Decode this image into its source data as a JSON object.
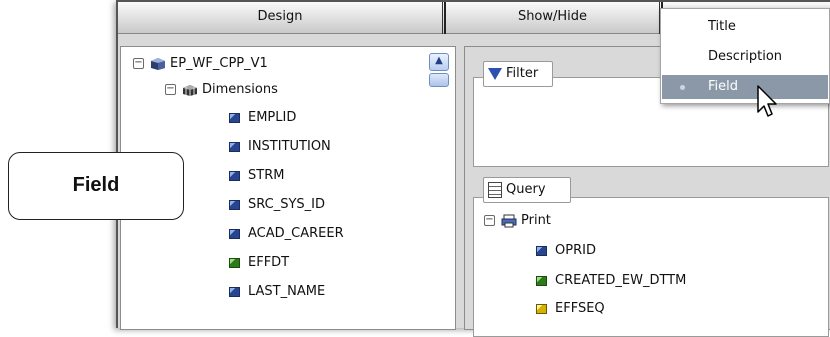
{
  "tabs": {
    "design": "Design",
    "show_hide": "Show/Hide"
  },
  "tree": {
    "root": "EP_WF_CPP_V1",
    "dimensions": "Dimensions",
    "fields": [
      {
        "label": "EMPLID",
        "icon": "field-blue-icon"
      },
      {
        "label": "INSTITUTION",
        "icon": "field-blue-icon"
      },
      {
        "label": "STRM",
        "icon": "field-blue-icon"
      },
      {
        "label": "SRC_SYS_ID",
        "icon": "field-blue-icon"
      },
      {
        "label": "ACAD_CAREER",
        "icon": "field-blue-icon"
      },
      {
        "label": "EFFDT",
        "icon": "field-green-icon"
      },
      {
        "label": "LAST_NAME",
        "icon": "field-blue-icon"
      }
    ]
  },
  "filter": {
    "label": "Filter"
  },
  "query": {
    "label": "Query",
    "print": "Print",
    "fields": [
      {
        "label": "OPRID",
        "icon": "field-blue-icon"
      },
      {
        "label": "CREATED_EW_DTTM",
        "icon": "field-green-icon"
      },
      {
        "label": "EFFSEQ",
        "icon": "field-yellow-icon"
      }
    ]
  },
  "menu": {
    "items": [
      "Title",
      "Description",
      "Field"
    ],
    "selected": "Field"
  },
  "callout": {
    "text": "Field"
  },
  "colors": {
    "menu_selected": "#8a98a8",
    "scroll_accent": "#b9cdf1"
  }
}
